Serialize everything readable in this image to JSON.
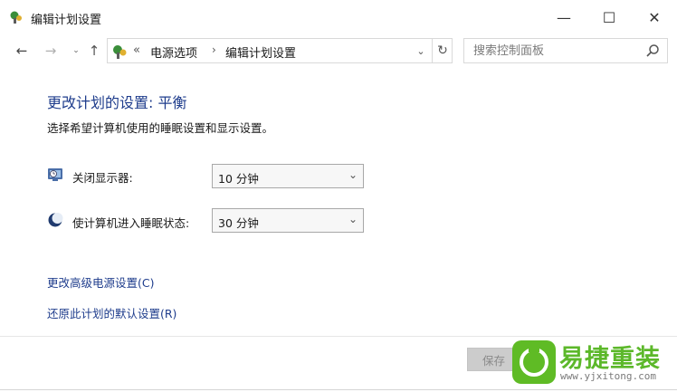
{
  "window": {
    "title": "编辑计划设置",
    "minimize_symbol": "—",
    "maximize_symbol": "☐",
    "close_symbol": "✕"
  },
  "nav": {
    "back_symbol": "←",
    "forward_symbol": "→",
    "recent_symbol": "⌄",
    "up_symbol": "↑",
    "overflow_symbol": "«",
    "breadcrumb": [
      "电源选项",
      "编辑计划设置"
    ],
    "separator": "›",
    "dropdown_symbol": "⌄",
    "refresh_symbol": "↻"
  },
  "search": {
    "placeholder": "搜索控制面板"
  },
  "content": {
    "title": "更改计划的设置: 平衡",
    "subtitle": "选择希望计算机使用的睡眠设置和显示设置。",
    "settings": [
      {
        "label": "关闭显示器:",
        "value": "10 分钟",
        "icon": "display-timer-icon"
      },
      {
        "label": "使计算机进入睡眠状态:",
        "value": "30 分钟",
        "icon": "sleep-moon-icon"
      }
    ],
    "caret_symbol": "⌄",
    "links": [
      "更改高级电源设置(C)",
      "还原此计划的默认设置(R)"
    ],
    "save_button": "保存"
  },
  "watermark": {
    "text": "易捷重装",
    "url": "www.yjxitong.com"
  },
  "colors": {
    "link": "#1e3c8c",
    "title": "#1e3c8c",
    "watermark_green": "#5cb82a"
  }
}
